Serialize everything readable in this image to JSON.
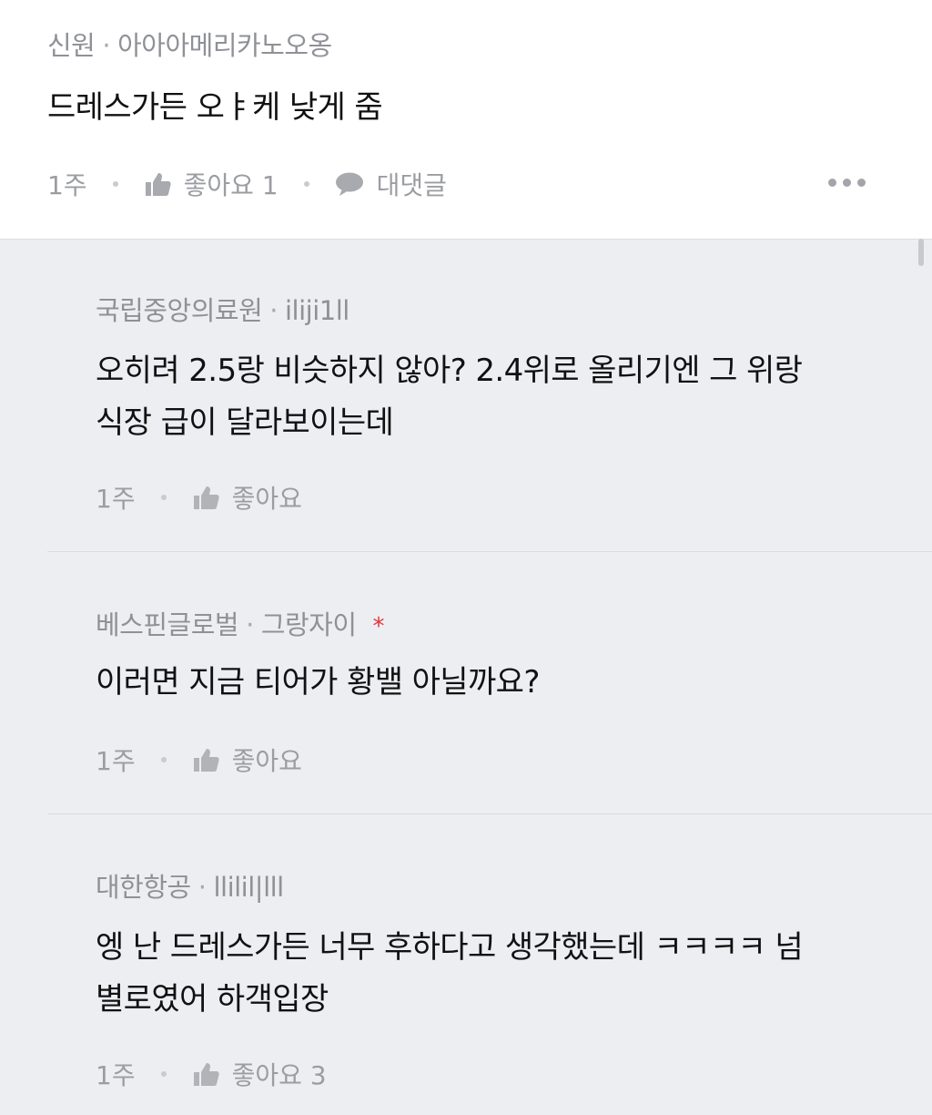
{
  "parent": {
    "company": "신원",
    "separator": "·",
    "nickname": "아아아메리카노오옹",
    "text": "드레스가든 오ㅑ케 낮게 줌",
    "time": "1주",
    "like_label": "좋아요 1",
    "reply_label": "대댓글"
  },
  "replies": [
    {
      "company": "국립중앙의료원",
      "nickname": "iliji1ll",
      "lines": [
        "오히려 2.5랑 비슷하지 않아? 2.4위로 올리기엔 그 위랑",
        "식장 급이 달라보이는데"
      ],
      "time": "1주",
      "like_label": "좋아요"
    },
    {
      "company": "베스핀글로벌",
      "nickname": "그랑자이",
      "badge": "*",
      "lines": [
        "이러면 지금 티어가 황밸 아닐까요?"
      ],
      "time": "1주",
      "like_label": "좋아요"
    },
    {
      "company": "대한항공",
      "nickname": "llilil|lll",
      "lines": [
        "엥 난 드레스가든 너무 후하다고 생각했는데 ㅋㅋㅋㅋ 넘",
        "별로였어 하객입장"
      ],
      "time": "1주",
      "like_label": "좋아요 3"
    }
  ],
  "colors": {
    "reply_bg": "#eceef2",
    "meta_text": "#8f9197",
    "body_text": "#111111",
    "badge_red": "#e5333a"
  },
  "icons": {
    "like": "thumbs-up-icon",
    "reply": "speech-bubble-icon",
    "more": "more-dots-icon"
  }
}
